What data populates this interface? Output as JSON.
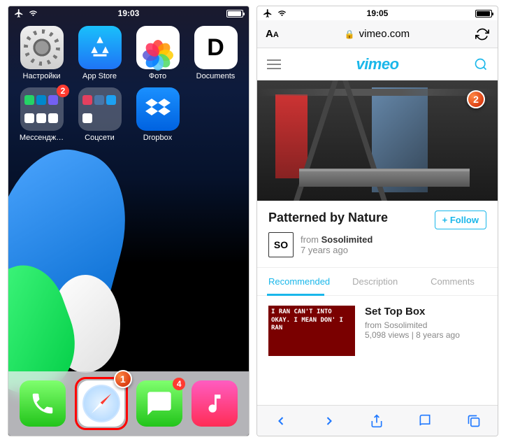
{
  "left": {
    "status_time": "19:03",
    "apps_row1": [
      {
        "label": "Настройки",
        "type": "settings"
      },
      {
        "label": "App Store",
        "type": "appstore"
      },
      {
        "label": "Фото",
        "type": "photos"
      },
      {
        "label": "Documents",
        "type": "docs",
        "letter": "D"
      }
    ],
    "apps_row2": [
      {
        "label": "Мессендж…",
        "type": "folder",
        "badge": "2",
        "minis": [
          "#25d366",
          "#0088cc",
          "#7360f2",
          "#fff",
          "#fff",
          "#fff"
        ]
      },
      {
        "label": "Соцсети",
        "type": "folder",
        "minis": [
          "#e4405f",
          "#4a76a8",
          "#1da1f2",
          "#fff"
        ]
      },
      {
        "label": "Dropbox",
        "type": "dropbox"
      }
    ],
    "dock": [
      {
        "type": "phone"
      },
      {
        "type": "safari",
        "highlight": true,
        "callout": "1"
      },
      {
        "type": "messages",
        "badge": "4"
      },
      {
        "type": "music"
      }
    ]
  },
  "right": {
    "status_time": "19:05",
    "url": "vimeo.com",
    "brand": "vimeo",
    "callout": "2",
    "video": {
      "title": "Patterned by Nature",
      "author_avatar": "SO",
      "from_label": "from",
      "author": "Sosolimited",
      "age": "7 years ago",
      "follow": "+ Follow"
    },
    "tabs": [
      "Recommended",
      "Description",
      "Comments"
    ],
    "rec": {
      "thumb_text": "I RAN CAN'T\nINTO OKAY.\nI MEAN DON'\nI RAN",
      "title": "Set Top Box",
      "from_label": "from",
      "author": "Sosolimited",
      "stats": "5,098 views | 8 years ago"
    }
  }
}
